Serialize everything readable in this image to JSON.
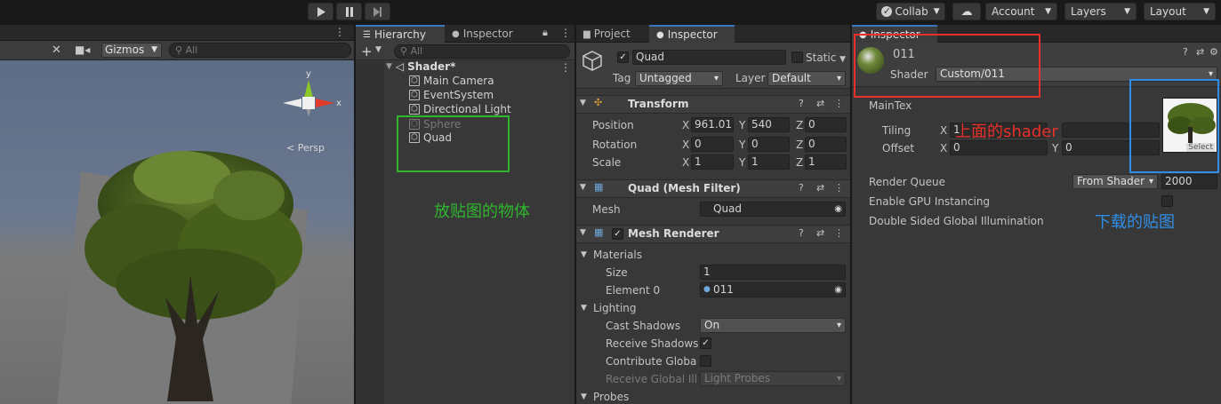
{
  "toolbar": {
    "play_icon": "play-icon",
    "pause_icon": "pause-icon",
    "step_icon": "step-icon",
    "collab_label": "Collab",
    "cloud_icon": "cloud-icon",
    "account_label": "Account",
    "layers_label": "Layers",
    "layout_label": "Layout"
  },
  "scene": {
    "gizmos_label": "Gizmos",
    "search_placeholder": "All",
    "persp_label": "Persp",
    "axis_y": "y",
    "axis_x": "x"
  },
  "hierarchy": {
    "tab_label": "Hierarchy",
    "tab2_label": "Inspector",
    "search_placeholder": "All",
    "scene_name": "Shader*",
    "items": [
      {
        "label": "Main Camera"
      },
      {
        "label": "EventSystem"
      },
      {
        "label": "Directional Light"
      },
      {
        "label": "Sphere"
      },
      {
        "label": "Quad"
      }
    ],
    "annotation": "放贴图的物体"
  },
  "inspector": {
    "tab_project": "Project",
    "tab_inspector": "Inspector",
    "object_name": "Quad",
    "static_label": "Static",
    "tag_label": "Tag",
    "tag_value": "Untagged",
    "layer_label": "Layer",
    "layer_value": "Default",
    "transform": {
      "title": "Transform",
      "position_label": "Position",
      "rotation_label": "Rotation",
      "scale_label": "Scale",
      "x": "X",
      "y": "Y",
      "z": "Z",
      "position": [
        "961.017",
        "540",
        "0"
      ],
      "rotation": [
        "0",
        "0",
        "0"
      ],
      "scale": [
        "1",
        "1",
        "1"
      ]
    },
    "mesh_filter": {
      "title": "Quad (Mesh Filter)",
      "mesh_label": "Mesh",
      "mesh_value": "Quad"
    },
    "mesh_renderer": {
      "title": "Mesh Renderer",
      "materials_label": "Materials",
      "size_label": "Size",
      "size_value": "1",
      "element0_label": "Element 0",
      "element0_value": "011",
      "lighting_label": "Lighting",
      "cast_shadows_label": "Cast Shadows",
      "cast_shadows_value": "On",
      "receive_shadows_label": "Receive Shadows",
      "contribute_gi_label": "Contribute Global I",
      "receive_gi_label": "Receive Global Illu",
      "receive_gi_value": "Light Probes",
      "probes_label": "Probes"
    }
  },
  "material": {
    "tab_label": "Inspector",
    "name": "011",
    "shader_label": "Shader",
    "shader_value": "Custom/011",
    "maintex_label": "MainTex",
    "tiling_label": "Tiling",
    "offset_label": "Offset",
    "x": "X",
    "y": "Y",
    "tiling_x": "1",
    "offset_x": "0",
    "offset_y": "0",
    "select_label": "Select",
    "render_queue_label": "Render Queue",
    "render_queue_mode": "From Shader",
    "render_queue_value": "2000",
    "gpu_instancing_label": "Enable GPU Instancing",
    "double_sided_gi_label": "Double Sided Global Illumination",
    "annotation_shader": "上面的shader",
    "annotation_texture": "下载的贴图"
  },
  "colors": {
    "annot_red": "#e8302a",
    "annot_green": "#2fb52f",
    "annot_blue": "#2f8fe8",
    "accent": "#3a79bb"
  }
}
